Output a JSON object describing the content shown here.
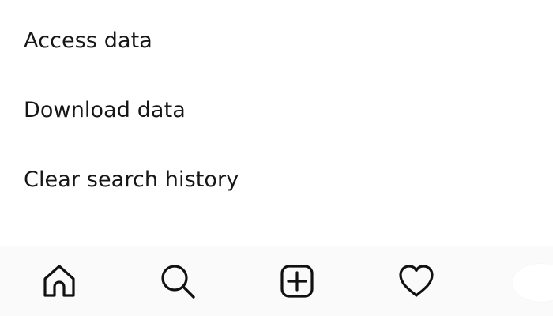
{
  "menu": {
    "items": [
      {
        "label": "Access data"
      },
      {
        "label": "Download data"
      },
      {
        "label": "Clear search history"
      }
    ]
  },
  "bottom_nav": {
    "items": [
      {
        "icon": "home-icon"
      },
      {
        "icon": "search-icon"
      },
      {
        "icon": "new-post-icon"
      },
      {
        "icon": "heart-icon"
      },
      {
        "icon": "profile-avatar"
      }
    ]
  },
  "colors": {
    "text": "#161616",
    "nav_background": "#fafafa",
    "divider": "#dbdbdb",
    "icon": "#111111"
  }
}
